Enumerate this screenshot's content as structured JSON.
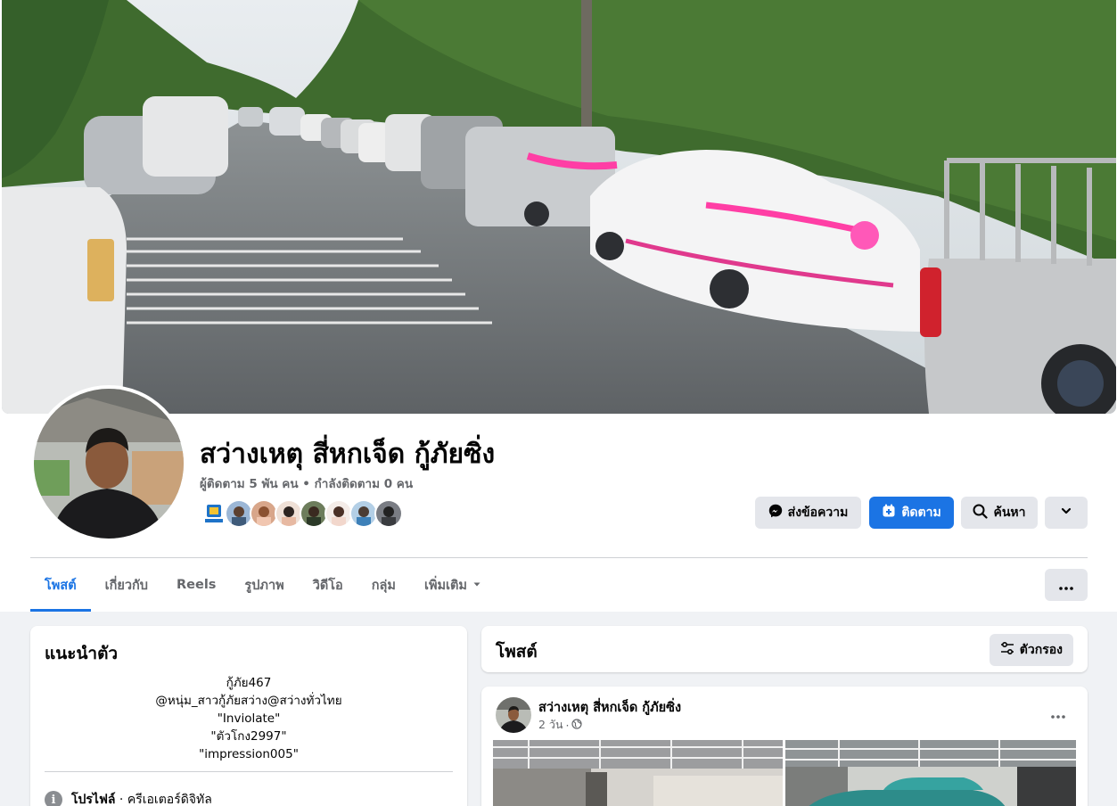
{
  "profile": {
    "name": "สว่างเหตุ สี่หกเจ็ด กู้ภัยซิ่ง",
    "follow_stats": "ผู้ติดตาม 5 พัน คน • กำลังติดตาม 0 คน"
  },
  "actions": {
    "message_label": "ส่งข้อความ",
    "follow_label": "ติดตาม",
    "search_label": "ค้นหา"
  },
  "tabs": [
    {
      "label": "โพสต์",
      "active": true
    },
    {
      "label": "เกี่ยวกับ",
      "active": false
    },
    {
      "label": "Reels",
      "active": false
    },
    {
      "label": "รูปภาพ",
      "active": false
    },
    {
      "label": "วิดีโอ",
      "active": false
    },
    {
      "label": "กลุ่ม",
      "active": false
    },
    {
      "label": "เพิ่มเติม",
      "active": false
    }
  ],
  "intro": {
    "title": "แนะนำตัว",
    "bio_lines": [
      "กู้ภัย467",
      "@หนุ่ม_สาวกู้ภัยสว่าง@สว่างทั่วไทย",
      "\"Inviolate\"",
      "\"ตัวโกง2997\"",
      "\"impression005\""
    ],
    "profile_type_label": "โปรไฟล์",
    "profile_type_value": "ครีเอเตอร์ดิจิทัล"
  },
  "posts_section": {
    "title": "โพสต์",
    "filter_label": "ตัวกรอง"
  },
  "post": {
    "author": "สว่างเหตุ สี่หกเจ็ด กู้ภัยซิ่ง",
    "time": "2 วัน",
    "separator": "·"
  },
  "friend_avatar_count": 8,
  "icons": {
    "messenger": "messenger-icon",
    "follow": "follow-plus-icon",
    "search": "search-icon",
    "chevron": "chevron-down-icon",
    "ellipsis": "ellipsis-icon",
    "filter": "filter-sliders-icon",
    "info": "info-icon",
    "globe": "globe-icon"
  },
  "colors": {
    "accent": "#1b74e4",
    "page_bg": "#f0f2f5",
    "secondary_text": "#65676b"
  }
}
